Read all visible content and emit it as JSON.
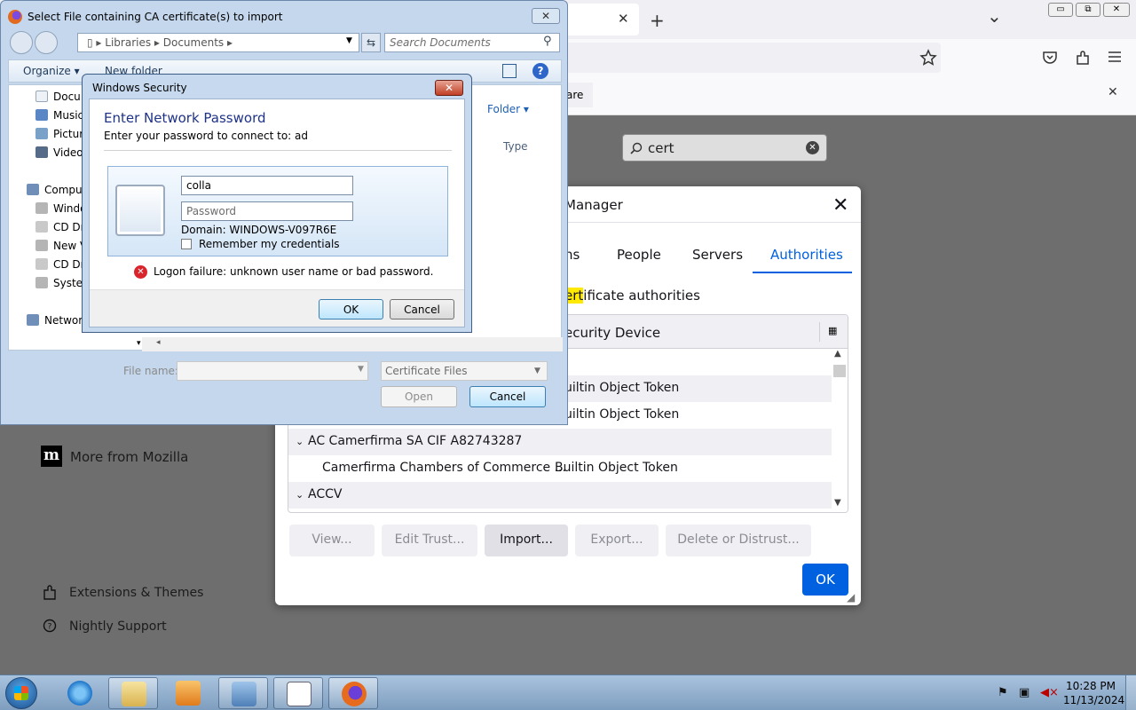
{
  "firefox": {
    "tab_close": "✕",
    "new_tab": "+",
    "tab_list": "⌄",
    "win_min": "▭",
    "win_max": "⧉",
    "win_close": "✕",
    "notif_text": "are",
    "notif_close": "✕",
    "search_value": "cert",
    "more_from_mozilla": "More from Mozilla",
    "extensions_themes": "Extensions & Themes",
    "nightly_support": "Nightly Support"
  },
  "cert_manager": {
    "title": "Manager",
    "tabs": [
      "ns",
      "People",
      "Servers",
      "Authorities"
    ],
    "description_pre": "",
    "description_hl": "ert",
    "description_post": "ificate authorities",
    "column_header": "ecurity Device",
    "rows": [
      {
        "name": "",
        "device": "uiltin Object Token"
      },
      {
        "name": "",
        "device": "uiltin Object Token"
      },
      {
        "name": "AC Camerfirma SA CIF A82743287",
        "device": ""
      },
      {
        "name": "Camerfirma Chambers of Commerce ...",
        "device": "Builtin Object Token"
      },
      {
        "name": "ACCV",
        "device": ""
      }
    ],
    "buttons": {
      "view": "View...",
      "edit_trust": "Edit Trust...",
      "import": "Import...",
      "export": "Export...",
      "delete": "Delete or Distrust..."
    },
    "ok": "OK"
  },
  "file_dialog": {
    "title": "Select File containing CA certificate(s) to import",
    "breadcrumb": [
      "Libraries",
      "Documents"
    ],
    "search_placeholder": "Search Documents",
    "organize": "Organize ▾",
    "new_folder": "New folder",
    "nav_items": [
      "Docu",
      "Music",
      "Pictur",
      "Video",
      "Comput",
      "Windo",
      "CD Dri",
      "New V",
      "CD Dri",
      "Syster",
      "Network"
    ],
    "arrange_by": "Folder ▾",
    "col_type": "Type",
    "file_name_label": "File name:",
    "file_name_value": "",
    "filter": "Certificate Files",
    "open": "Open",
    "cancel": "Cancel"
  },
  "security_dialog": {
    "title": "Windows Security",
    "heading": "Enter Network Password",
    "subtitle": "Enter your password to connect to: ad",
    "username_value": "colla",
    "password_placeholder": "Password",
    "domain": "Domain: WINDOWS-V097R6E",
    "remember": "Remember my credentials",
    "error": "Logon failure: unknown user name or bad password.",
    "ok": "OK",
    "cancel": "Cancel"
  },
  "taskbar": {
    "time": "10:28 PM",
    "date": "11/13/2024"
  }
}
